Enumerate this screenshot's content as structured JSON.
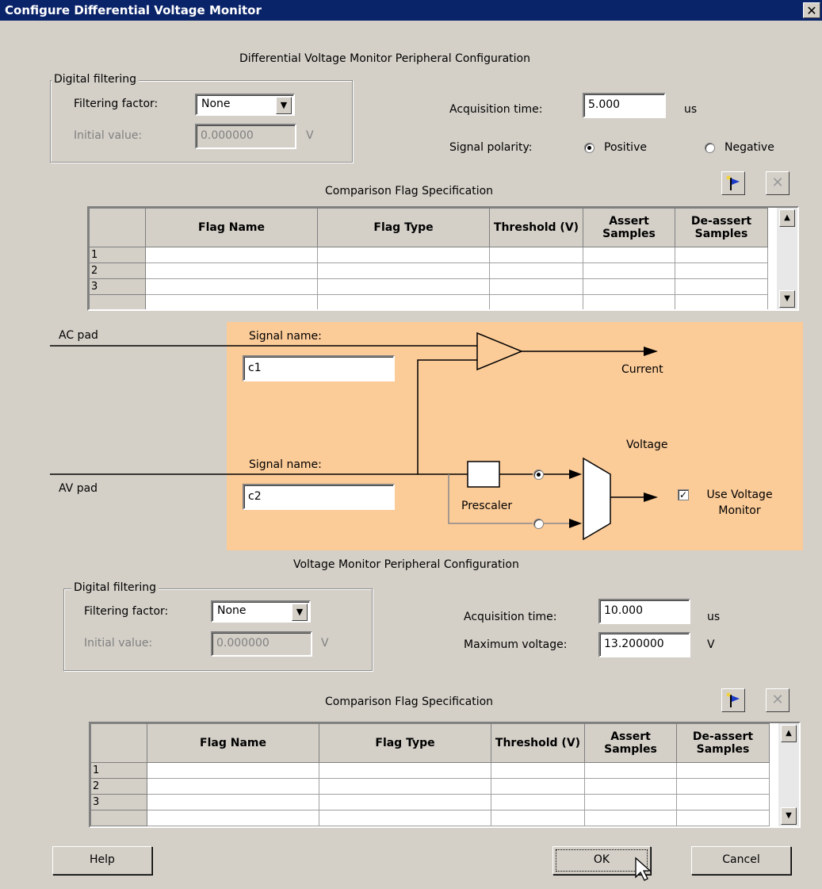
{
  "window": {
    "title": "Configure Differential Voltage Monitor",
    "close_symbol": "✕"
  },
  "dvm": {
    "section_title": "Differential Voltage Monitor Peripheral Configuration",
    "digital_filtering": {
      "legend": "Digital filtering",
      "filtering_factor_label": "Filtering factor:",
      "filtering_factor_value": "None",
      "initial_value_label": "Initial value:",
      "initial_value": "0.000000",
      "initial_value_unit": "V"
    },
    "acquisition_time_label": "Acquisition  time:",
    "acquisition_time": "5.000",
    "acquisition_time_unit": "us",
    "signal_polarity_label": "Signal polarity:",
    "polarity_positive": "Positive",
    "polarity_negative": "Negative",
    "polarity_selected": "Positive",
    "comparison_title": "Comparison Flag Specification",
    "table": {
      "columns": [
        "",
        "Flag Name",
        "Flag Type",
        "Threshold (V)",
        "Assert Samples",
        "De-assert Samples"
      ],
      "rows": [
        "1",
        "2",
        "3"
      ]
    }
  },
  "diagram": {
    "ac_pad": "AC pad",
    "av_pad": "AV pad",
    "signal_name_label_1": "Signal name:",
    "signal_name_1": "c1",
    "signal_name_label_2": "Signal name:",
    "signal_name_2": "c2",
    "current_label": "Current",
    "voltage_label": "Voltage",
    "prescaler_label": "Prescaler",
    "use_voltage_monitor_label": "Use Voltage Monitor",
    "use_voltage_monitor_checked": true,
    "prescaler_path_selected": true,
    "background_color": "#fbcb98"
  },
  "vm": {
    "section_title": "Voltage Monitor Peripheral Configuration",
    "digital_filtering": {
      "legend": "Digital filtering",
      "filtering_factor_label": "Filtering factor:",
      "filtering_factor_value": "None",
      "initial_value_label": "Initial value:",
      "initial_value": "0.000000",
      "initial_value_unit": "V"
    },
    "acquisition_time_label": "Acquisition  time:",
    "acquisition_time": "10.000",
    "acquisition_time_unit": "us",
    "maximum_voltage_label": "Maximum voltage:",
    "maximum_voltage": "13.200000",
    "maximum_voltage_unit": "V",
    "comparison_title": "Comparison Flag Specification",
    "table": {
      "columns": [
        "",
        "Flag Name",
        "Flag Type",
        "Threshold (V)",
        "Assert Samples",
        "De-assert Samples"
      ],
      "rows": [
        "1",
        "2",
        "3"
      ]
    }
  },
  "buttons": {
    "help": "Help",
    "ok": "OK",
    "cancel": "Cancel"
  },
  "icons": {
    "add_flag": "add-flag-icon",
    "delete_flag": "delete-icon"
  }
}
